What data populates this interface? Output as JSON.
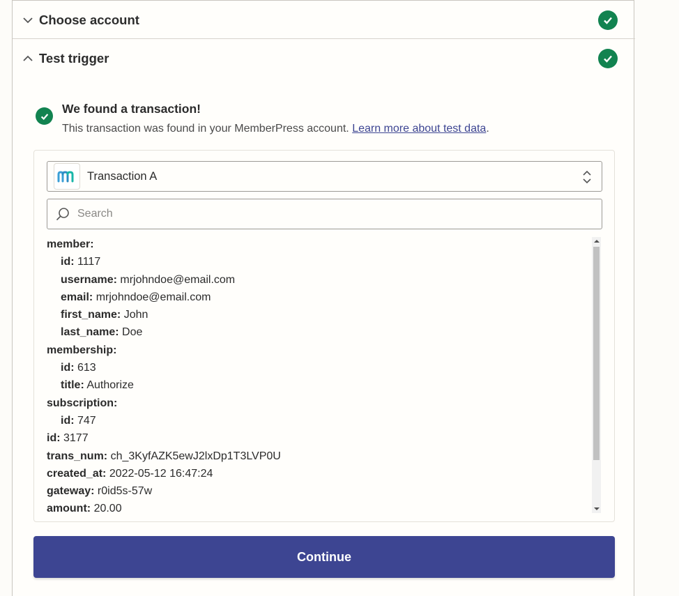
{
  "sections": [
    {
      "title": "Choose account",
      "expanded": false,
      "status": "complete"
    },
    {
      "title": "Test trigger",
      "expanded": true,
      "status": "complete"
    }
  ],
  "result": {
    "title": "We found a transaction!",
    "description": "This transaction was found in your MemberPress account. ",
    "link_label": "Learn more about test data",
    "description_end": "."
  },
  "selector": {
    "app_icon": "memberpress-logo-icon",
    "value": "Transaction A"
  },
  "search": {
    "placeholder": "Search"
  },
  "data_rows": [
    {
      "key": "member:",
      "value": "",
      "indent": 0
    },
    {
      "key": "id:",
      "value": "1117",
      "indent": 1
    },
    {
      "key": "username:",
      "value": "mrjohndoe@email.com",
      "indent": 1
    },
    {
      "key": "email:",
      "value": "mrjohndoe@email.com",
      "indent": 1
    },
    {
      "key": "first_name:",
      "value": "John",
      "indent": 1
    },
    {
      "key": "last_name:",
      "value": "Doe",
      "indent": 1
    },
    {
      "key": "membership:",
      "value": "",
      "indent": 0
    },
    {
      "key": "id:",
      "value": "613",
      "indent": 1
    },
    {
      "key": "title:",
      "value": "Authorize",
      "indent": 1
    },
    {
      "key": "subscription:",
      "value": "",
      "indent": 0
    },
    {
      "key": "id:",
      "value": "747",
      "indent": 1
    },
    {
      "key": "id:",
      "value": "3177",
      "indent": 0
    },
    {
      "key": "trans_num:",
      "value": "ch_3KyfAZK5ewJ2lxDp1T3LVP0U",
      "indent": 0
    },
    {
      "key": "created_at:",
      "value": "2022-05-12 16:47:24",
      "indent": 0
    },
    {
      "key": "gateway:",
      "value": "r0id5s-57w",
      "indent": 0
    },
    {
      "key": "amount:",
      "value": "20.00",
      "indent": 0
    }
  ],
  "continue_label": "Continue",
  "colors": {
    "accent": "#3d4592",
    "success": "#128350"
  }
}
